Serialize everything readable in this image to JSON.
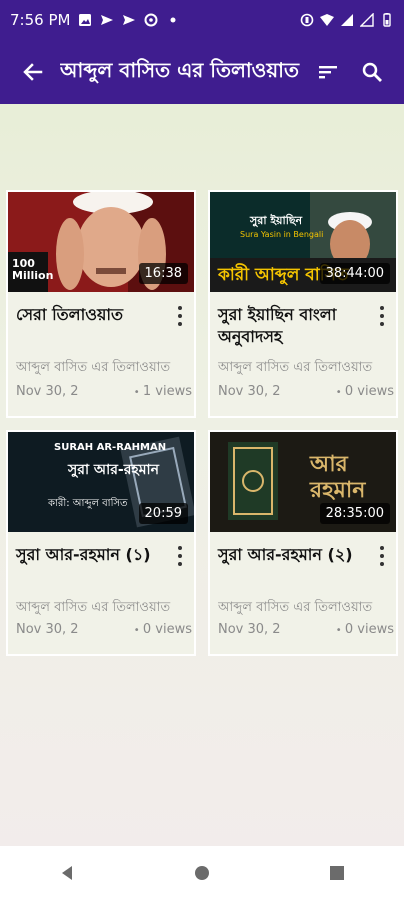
{
  "status_bar": {
    "time": "7:56 PM",
    "icons": [
      "image-icon",
      "send-icon",
      "send-icon",
      "speed-icon",
      "dot-icon",
      "vibrate-icon",
      "wifi-icon",
      "signal-icon",
      "signal-icon",
      "battery-icon"
    ]
  },
  "app_bar": {
    "title": "আব্দুল বাসিত এর তিলাওয়াত",
    "icons": [
      "back-arrow-icon",
      "sort-icon",
      "search-icon"
    ]
  },
  "videos": [
    {
      "title": "সেরা তিলাওয়াত",
      "channel": "আব্দুল বাসিত এর তিলাওয়াত",
      "date": "Nov 30, 2",
      "views": "1 views",
      "duration": "16:38",
      "thumb_text": "100 Million",
      "thumb_colors": [
        "#8b1a1a",
        "#c23b2b",
        "#f0d2b8"
      ]
    },
    {
      "title": "সুরা ইয়াছিন বাংলা অনুবাদসহ",
      "channel": "আব্দুল বাসিত এর তিলাওয়াত",
      "date": "Nov 30, 2",
      "views": "0 views",
      "duration": "38:44:00",
      "thumb_text": "সুরা ইয়াছিন",
      "thumb_caption": "Sura Yasin in Bengali",
      "thumb_banner": "কারী আব্দুল বাসিত",
      "thumb_colors": [
        "#0b2c2a",
        "#f4c400",
        "#1a1a1a"
      ]
    },
    {
      "title": "সুরা আর-রহমান (১)",
      "channel": "আব্দুল বাসিত এর তিলাওয়াত",
      "date": "Nov 30, 2",
      "views": "0 views",
      "duration": "20:59",
      "thumb_text": "SURAH AR-RAHMAN",
      "thumb_sub": "সুরা আর-রহমান",
      "thumb_caption": "কারী: আব্দুল বাসিত",
      "thumb_colors": [
        "#0e1b22",
        "#2f3c45",
        "#ffffff"
      ]
    },
    {
      "title": "সুরা আর-রহমান (২)",
      "channel": "আব্দুল বাসিত এর তিলাওয়াত",
      "date": "Nov 30, 2",
      "views": "0 views",
      "duration": "28:35:00",
      "thumb_text": "আর রহমান",
      "thumb_colors": [
        "#1c1a14",
        "#3a3326",
        "#d9b66b"
      ]
    }
  ],
  "nav": {
    "icons": [
      "back-triangle-icon",
      "home-circle-icon",
      "recents-square-icon"
    ]
  },
  "colors": {
    "primary": "#3f1d8f",
    "card_bg": "#f1f2e8",
    "muted_text": "#8a8a8a"
  }
}
